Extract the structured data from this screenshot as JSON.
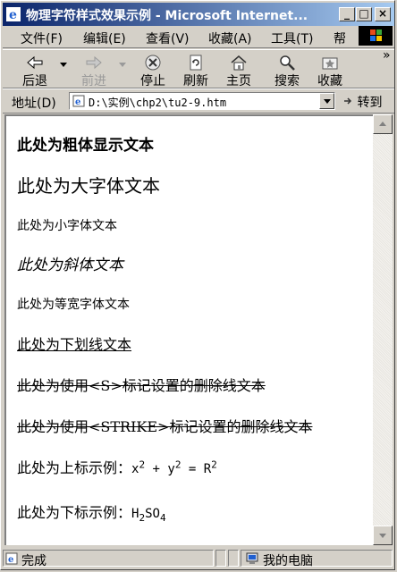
{
  "window": {
    "title": "物理字符样式效果示例 - Microsoft Internet...",
    "minimize": "_",
    "maximize": "□",
    "close": "×"
  },
  "menu": [
    "文件(F)",
    "编辑(E)",
    "查看(V)",
    "收藏(A)",
    "工具(T)",
    "帮"
  ],
  "toolbar": {
    "back": "后退",
    "forward": "前进",
    "stop": "停止",
    "refresh": "刷新",
    "home": "主页",
    "search": "搜索",
    "favorites": "收藏",
    "more": "»"
  },
  "address": {
    "label": "地址(D)",
    "url": "D:\\实例\\chp2\\tu2-9.htm",
    "go": "转到"
  },
  "page": {
    "bold": "此处为粗体显示文本",
    "big": "此处为大字体文本",
    "small": "此处为小字体文本",
    "italic": "此处为斜体文本",
    "tt": "此处为等宽字体文本",
    "underline": "此处为下划线文本",
    "strike_s": "此处为使用<S>标记设置的删除线文本",
    "strike_strike": "此处为使用<STRIKE>标记设置的删除线文本",
    "sup_prefix": "此处为上标示例：",
    "sup_formula": {
      "x": "x",
      "xexp": "2",
      "plus": " + ",
      "y": "y",
      "yexp": "2",
      "eq": " = ",
      "r": "R",
      "rexp": "2"
    },
    "sub_prefix": "此处为下标示例：",
    "sub_formula": {
      "h": "H",
      "hsub": "2",
      "so": "SO",
      "osub": "4"
    }
  },
  "status": {
    "text": "完成",
    "zone": "我的电脑"
  }
}
